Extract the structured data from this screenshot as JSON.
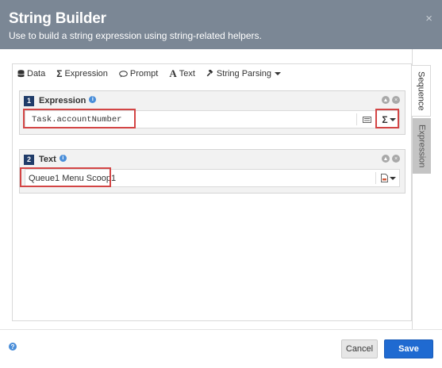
{
  "dialog": {
    "title": "String Builder",
    "subtitle": "Use to build a string expression using string-related helpers.",
    "close_glyph": "×"
  },
  "toolbar": {
    "items": [
      {
        "label": "Data",
        "icon": "database-icon"
      },
      {
        "label": "Expression",
        "icon": "sigma-icon"
      },
      {
        "label": "Prompt",
        "icon": "speech-bubble-icon"
      },
      {
        "label": "Text",
        "icon": "text-a-icon"
      },
      {
        "label": "String Parsing",
        "icon": "gavel-icon",
        "has_dropdown": true
      }
    ]
  },
  "sequence": [
    {
      "number": "1",
      "label": "Expression",
      "value": "Task.accountNumber",
      "type_button_icon": "sigma-icon",
      "aux_button_icon": "keyboard-icon",
      "highlight_color": "#d34545"
    },
    {
      "number": "2",
      "label": "Text",
      "value": "Queue1 Menu Scoop1",
      "type_button_icon": "document-icon",
      "highlight_color": "#d34545"
    }
  ],
  "side_tabs": {
    "active": "Sequence",
    "inactive": "Expression"
  },
  "footer": {
    "cancel_label": "Cancel",
    "save_label": "Save",
    "help_glyph": "?"
  },
  "colors": {
    "header_bg": "#7b8795",
    "primary": "#1f6ad1",
    "step_badge": "#1f3b69",
    "info_blue": "#4a8ed9"
  }
}
